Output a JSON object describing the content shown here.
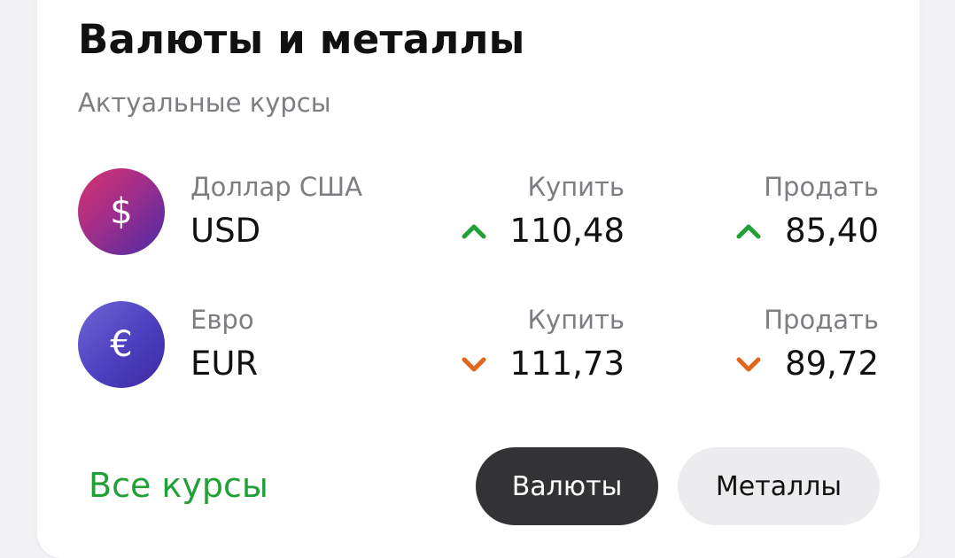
{
  "header": {
    "title": "Валюты и металлы",
    "subtitle": "Актуальные курсы"
  },
  "rates": [
    {
      "icon": "dollar-icon",
      "symbol": "$",
      "name": "Доллар США",
      "code": "USD",
      "buy_label": "Купить",
      "buy_value": "110,48",
      "buy_trend": "up",
      "sell_label": "Продать",
      "sell_value": "85,40",
      "sell_trend": "up"
    },
    {
      "icon": "euro-icon",
      "symbol": "€",
      "name": "Евро",
      "code": "EUR",
      "buy_label": "Купить",
      "buy_value": "111,73",
      "buy_trend": "down",
      "sell_label": "Продать",
      "sell_value": "89,72",
      "sell_trend": "down"
    }
  ],
  "footer": {
    "all_rates_link": "Все курсы",
    "tabs": [
      {
        "label": "Валюты",
        "selected": true
      },
      {
        "label": "Металлы",
        "selected": false
      }
    ]
  },
  "colors": {
    "up": "#21a038",
    "down": "#e0661a",
    "link": "#21a038"
  }
}
